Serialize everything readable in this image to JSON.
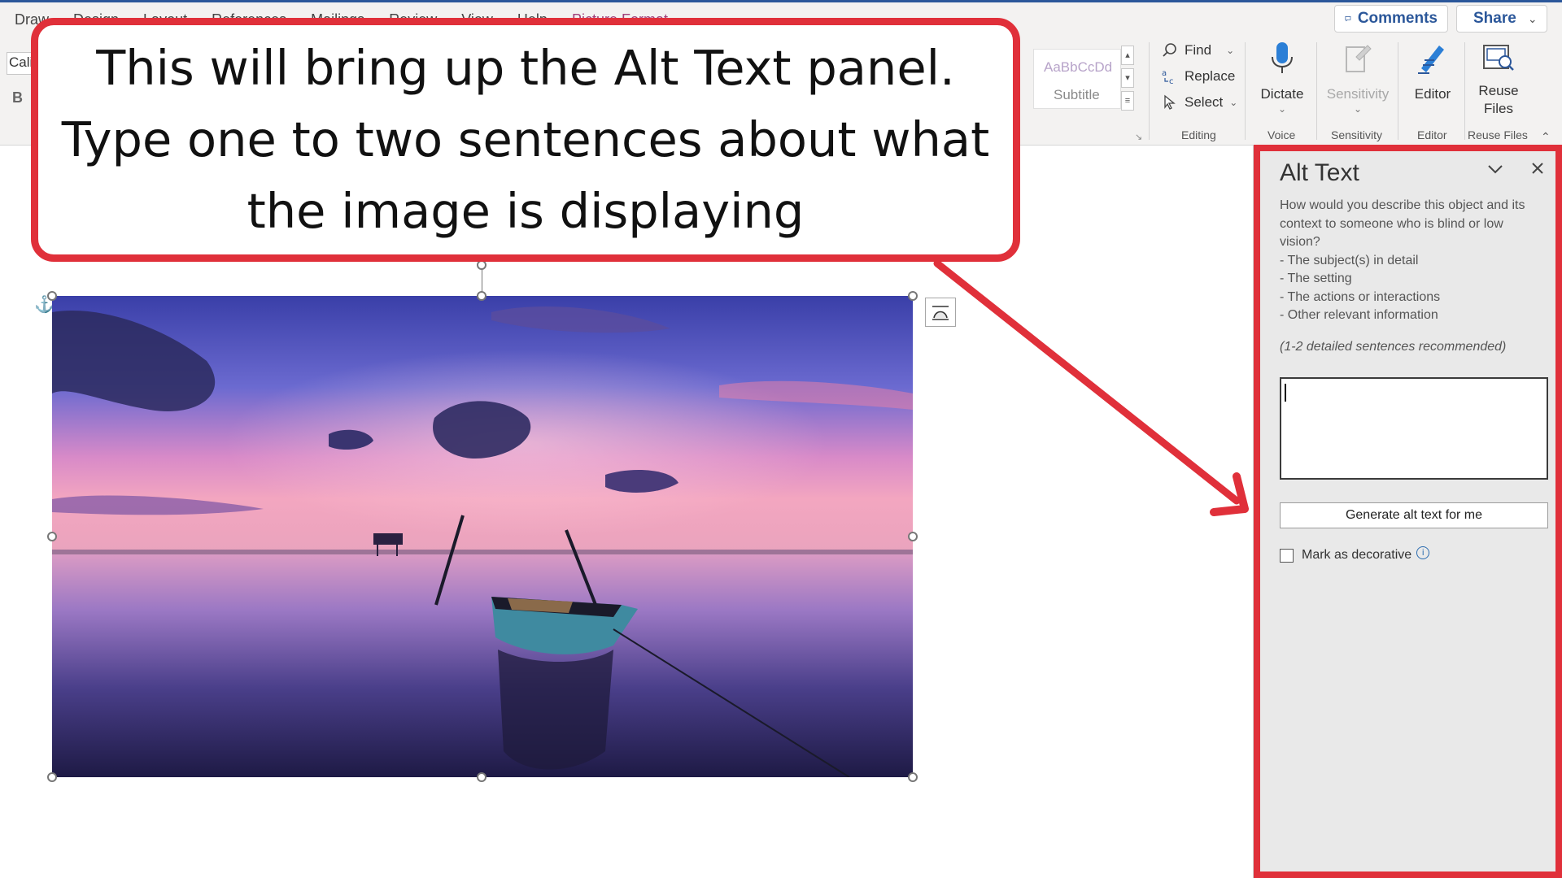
{
  "ribbon": {
    "tabs": [
      "Draw",
      "Design",
      "Layout",
      "References",
      "Mailings",
      "Review",
      "View",
      "Help",
      "Picture Format"
    ],
    "font_name": "Cali",
    "bold_label": "B",
    "comments_label": "Comments",
    "share_label": "Share",
    "styles": {
      "sample": "AaBbCcDd",
      "name": "Subtitle"
    },
    "editing": {
      "find": "Find",
      "replace": "Replace",
      "select": "Select",
      "group_label": "Editing"
    },
    "voice": {
      "dictate": "Dictate",
      "group_label": "Voice"
    },
    "sensitivity": {
      "button": "Sensitivity",
      "group_label": "Sensitivity"
    },
    "editor": {
      "button": "Editor",
      "group_label": "Editor"
    },
    "reuse_files": {
      "line1": "Reuse",
      "line2": "Files",
      "group_label": "Reuse Files"
    }
  },
  "callout": {
    "lines": [
      "This will bring up the Alt Text panel.",
      "Type one to two sentences about what",
      "the image is displaying"
    ],
    "color": "#e0303a"
  },
  "alt_text_pane": {
    "title": "Alt Text",
    "description_lines": [
      "How would you describe this object and its",
      "context to someone who is blind or low",
      "vision?",
      "- The subject(s) in detail",
      "- The setting",
      "- The actions or interactions",
      "- Other relevant information"
    ],
    "hint": "(1-2 detailed sentences recommended)",
    "input_value": "",
    "generate_button": "Generate alt text for me",
    "decorative_label": "Mark as decorative",
    "decorative_checked": false
  },
  "colors": {
    "word_blue": "#2b579a",
    "annotation_red": "#e0303a"
  }
}
